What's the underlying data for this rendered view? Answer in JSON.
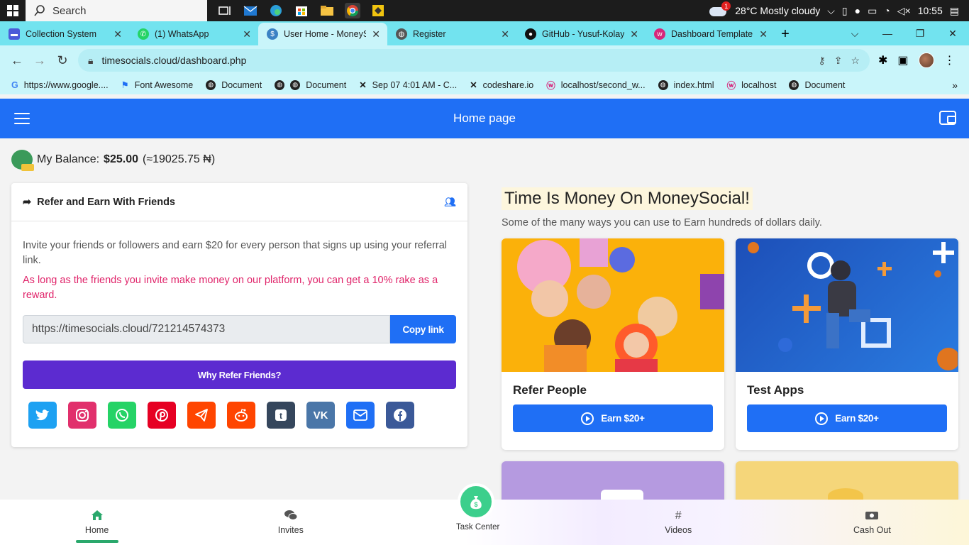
{
  "taskbar": {
    "search_label": "Search",
    "weather_badge": "1",
    "weather_text": "28°C  Mostly cloudy",
    "time": "10:55"
  },
  "tabs": [
    {
      "label": "Collection System",
      "color": "#4b5bd8"
    },
    {
      "label": "(1) WhatsApp",
      "color": "#25d366"
    },
    {
      "label": "User Home - MoneySo",
      "color": "#3b82c4"
    },
    {
      "label": "Register",
      "color": "#555555"
    },
    {
      "label": "GitHub - Yusuf-Kolayo",
      "color": "#111111"
    },
    {
      "label": "Dashboard Template -",
      "color": "#d6277b"
    }
  ],
  "address": {
    "url": "timesocials.cloud/dashboard.php"
  },
  "bookmarks": [
    "https://www.google....",
    "Font Awesome",
    "Document",
    "Document",
    "Sep 07 4:01 AM - C...",
    "codeshare.io",
    "localhost/second_w...",
    "index.html",
    "localhost",
    "Document"
  ],
  "app": {
    "title": "Home page"
  },
  "balance": {
    "label": "My Balance:",
    "amount": "$25.00",
    "naira": "(≈19025.75 ₦)"
  },
  "refer": {
    "title": "Refer and Earn With Friends",
    "text1": "Invite your friends or followers and earn $20 for every person that signs up using your referral link.",
    "text2": "As long as the friends you invite make money on our platform, you can get a 10% rake as a reward.",
    "link": "https://timesocials.cloud/721214574373",
    "copy_label": "Copy link",
    "why_label": "Why Refer Friends?"
  },
  "socials": [
    {
      "name": "twitter",
      "color": "#1da1f2",
      "glyph": "𝕥"
    },
    {
      "name": "instagram",
      "color": "#e1306c",
      "glyph": "◎"
    },
    {
      "name": "whatsapp",
      "color": "#25d366",
      "glyph": "✆"
    },
    {
      "name": "pinterest",
      "color": "#e60023",
      "glyph": "P"
    },
    {
      "name": "telegram",
      "color": "#ff4500",
      "glyph": "➤"
    },
    {
      "name": "reddit",
      "color": "#ff4500",
      "glyph": "☺"
    },
    {
      "name": "tumblr",
      "color": "#35465c",
      "glyph": "t"
    },
    {
      "name": "vk",
      "color": "#4a76a8",
      "glyph": "VK"
    },
    {
      "name": "email",
      "color": "#1f6ff5",
      "glyph": "✉"
    },
    {
      "name": "facebook",
      "color": "#3b5998",
      "glyph": "f"
    }
  ],
  "promo": {
    "title": "Time Is Money On MoneySocial!",
    "subtitle": "Some of the many ways you can use to Earn hundreds of dollars daily."
  },
  "tasks": [
    {
      "title": "Refer People",
      "button": "Earn $20+"
    },
    {
      "title": "Test Apps",
      "button": "Earn $20+"
    }
  ],
  "bottom_nav": {
    "home": "Home",
    "invites": "Invites",
    "task_center": "Task Center",
    "videos": "Videos",
    "cash_out": "Cash Out"
  }
}
